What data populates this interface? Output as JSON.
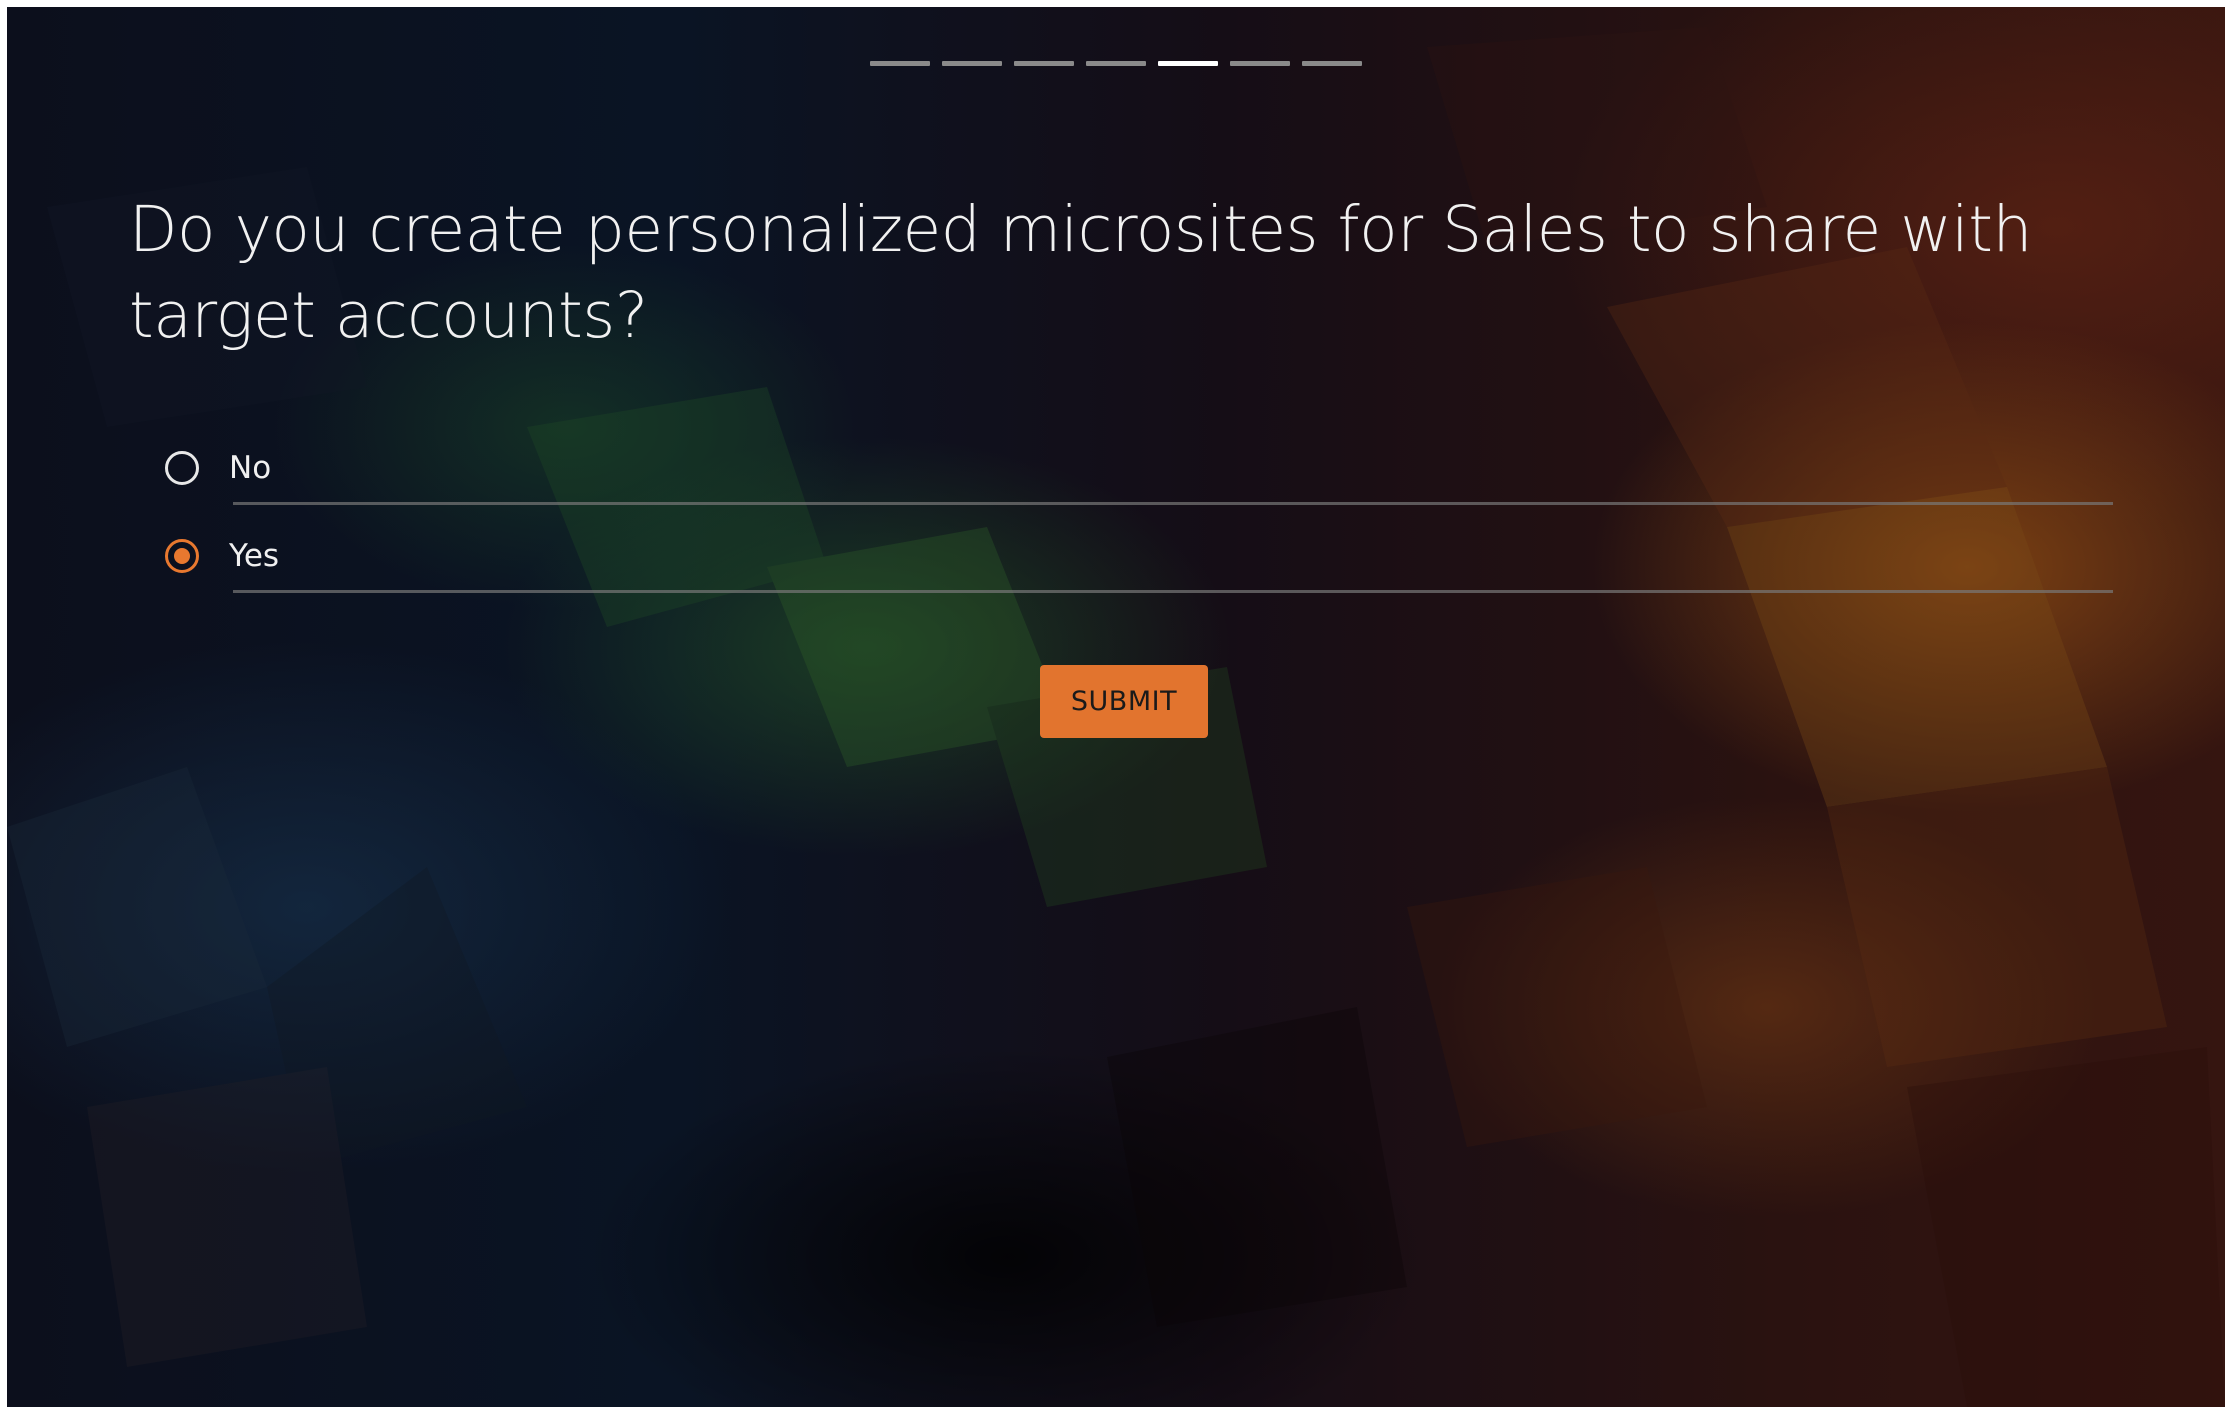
{
  "progress": {
    "total_steps": 7,
    "current_step": 5
  },
  "question": {
    "text": "Do you create personalized microsites for Sales to share with target accounts?"
  },
  "options": [
    {
      "label": "No",
      "selected": false
    },
    {
      "label": "Yes",
      "selected": true
    }
  ],
  "submit": {
    "label": "SUBMIT"
  },
  "colors": {
    "accent": "#e2742e",
    "text": "#f0f0f0",
    "progress_inactive": "#8a8a8a",
    "progress_active": "#ffffff"
  }
}
